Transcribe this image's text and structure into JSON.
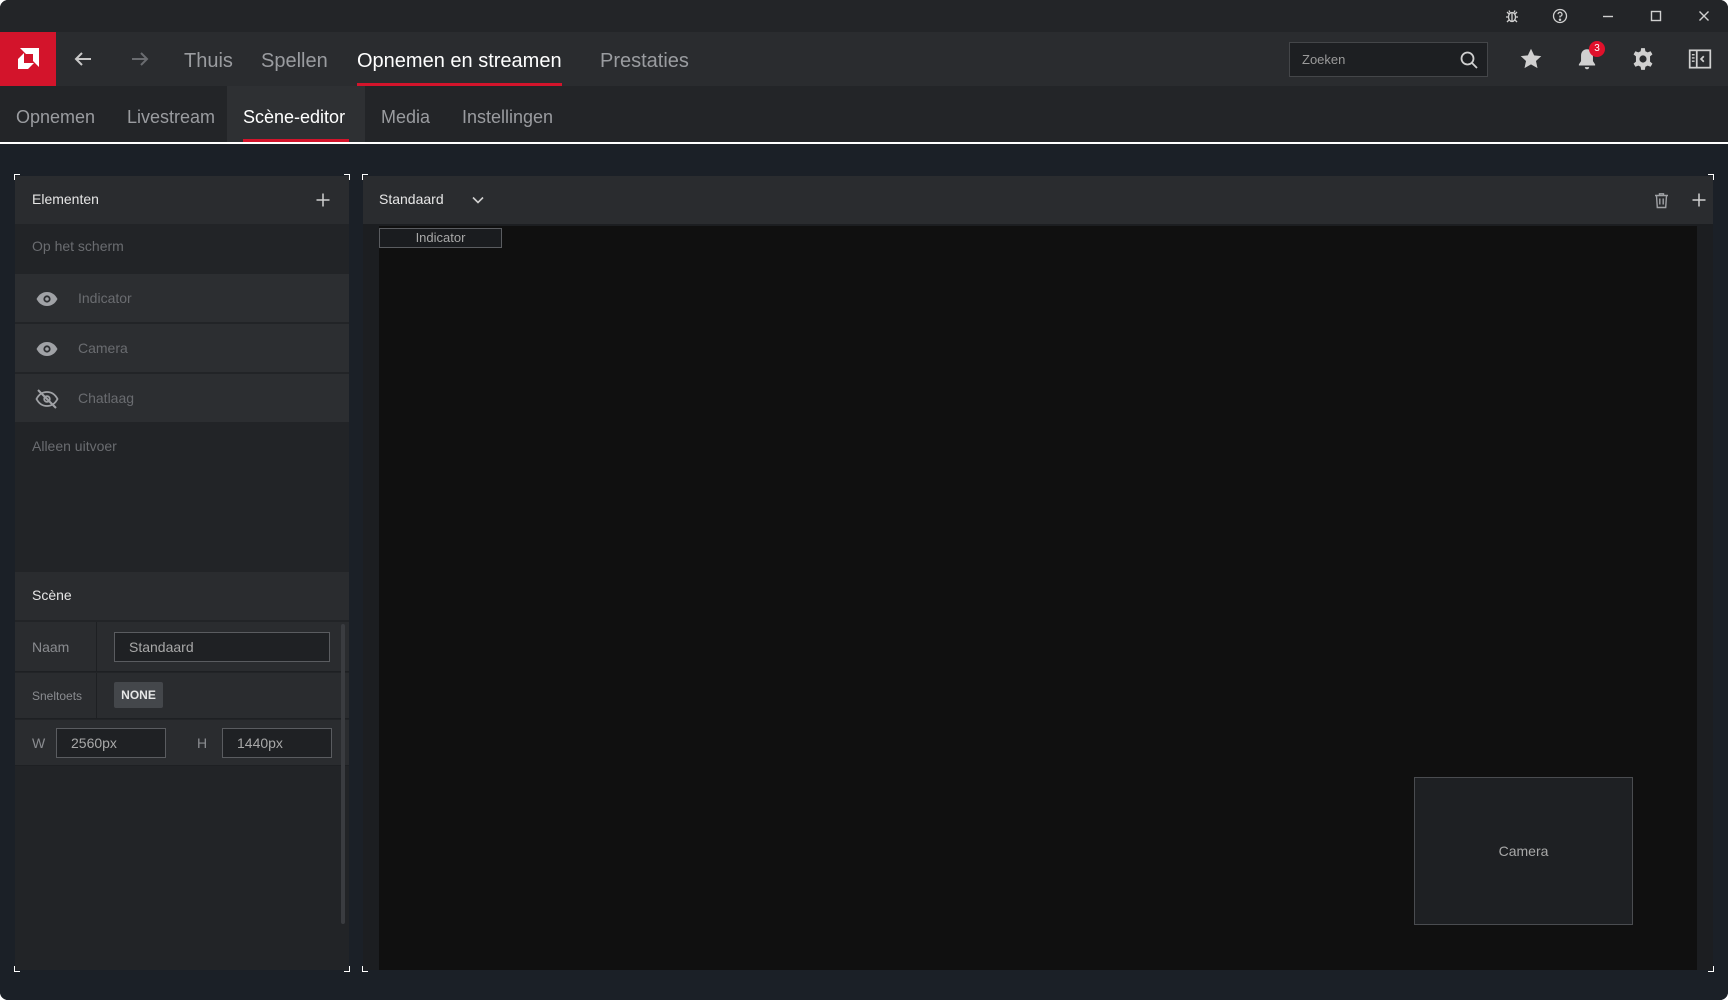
{
  "titlebar": {
    "buttons": [
      "bug-report-icon",
      "help-icon",
      "minimize-icon",
      "maximize-icon",
      "close-icon"
    ]
  },
  "mainnav": {
    "tabs": [
      {
        "label": "Thuis"
      },
      {
        "label": "Spellen"
      },
      {
        "label": "Opnemen en streamen"
      },
      {
        "label": "Prestaties"
      }
    ],
    "active_tab": "Opnemen en streamen",
    "search": {
      "placeholder": "Zoeken",
      "value": ""
    },
    "notifications": {
      "count": "3"
    }
  },
  "subnav": {
    "tabs": [
      {
        "label": "Opnemen"
      },
      {
        "label": "Livestream"
      },
      {
        "label": "Scène-editor"
      },
      {
        "label": "Media"
      },
      {
        "label": "Instellingen"
      }
    ],
    "active_tab": "Scène-editor"
  },
  "elements_panel": {
    "title": "Elementen",
    "on_screen_label": "Op het scherm",
    "items": [
      {
        "label": "Indicator",
        "icon": "eye-icon"
      },
      {
        "label": "Camera",
        "icon": "eye-icon"
      },
      {
        "label": "Chatlaag",
        "icon": "eye-off-icon"
      }
    ],
    "output_only_label": "Alleen uitvoer"
  },
  "scene_panel": {
    "title": "Scène",
    "name_label": "Naam",
    "name_value": "Standaard",
    "hotkey_label": "Sneltoets",
    "hotkey_value": "NONE",
    "width_label": "W",
    "width_value": "2560px",
    "height_label": "H",
    "height_value": "1440px"
  },
  "canvas": {
    "scene_name": "Standaard",
    "indicator_label": "Indicator",
    "camera_label": "Camera"
  },
  "colors": {
    "accent": "#d3142b",
    "background": "#232528",
    "panel": "#2a2c2f"
  }
}
